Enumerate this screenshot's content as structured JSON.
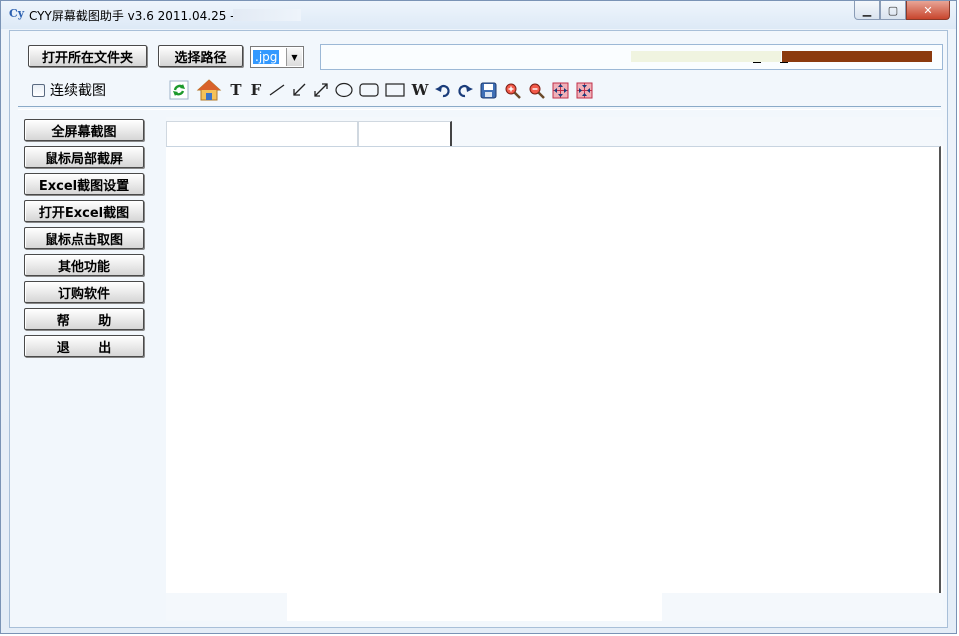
{
  "window": {
    "title": "CYY屏幕截图助手 v3.6 2011.04.25 -",
    "logo_main": "C",
    "logo_sub": "y",
    "minimize_glyph": "▁",
    "maximize_glyph": "▢",
    "close_glyph": "✕"
  },
  "top": {
    "open_folder_label": "打开所在文件夹",
    "choose_path_label": "选择路径",
    "format_value": ".jpg",
    "dropdown_glyph": "▼",
    "continuous_label": "连续截图"
  },
  "toolbar": {
    "text_tool_T": "T",
    "text_tool_F": "F",
    "text_tool_W": "W",
    "icons": [
      "refresh-icon",
      "home-icon",
      "text-t-icon",
      "text-f-icon",
      "line-icon",
      "arrow-icon",
      "double-arrow-icon",
      "ellipse-icon",
      "rounded-rect-icon",
      "rect-icon",
      "text-w-icon",
      "undo-icon",
      "redo-icon",
      "save-icon",
      "zoom-in-icon",
      "zoom-out-icon",
      "grid-expand-icon",
      "grid-shrink-icon"
    ]
  },
  "sidebar": {
    "items": [
      {
        "label": "全屏幕截图"
      },
      {
        "label": "鼠标局部截屏"
      },
      {
        "label": "Excel截图设置"
      },
      {
        "label": "打开Excel截图"
      },
      {
        "label": "鼠标点击取图"
      },
      {
        "label": "其他功能"
      },
      {
        "label": "订购软件"
      },
      {
        "label": "帮 助"
      },
      {
        "label": "退 出"
      }
    ]
  },
  "colors": {
    "accent": "#3399ff",
    "path_bar_brown": "#8b3a0e",
    "close_red": "#c8452d"
  }
}
